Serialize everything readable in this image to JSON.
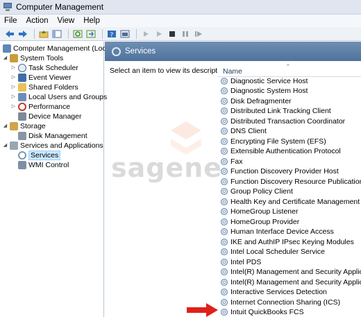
{
  "window": {
    "title": "Computer Management"
  },
  "menu": {
    "items": [
      "File",
      "Action",
      "View",
      "Help"
    ]
  },
  "toolbar": {
    "icons": [
      "back-arrow",
      "forward-arrow",
      "up-folder",
      "show-hide-tree",
      "refresh",
      "export",
      "help",
      "properties",
      "play",
      "play-next",
      "stop",
      "pause",
      "restart"
    ]
  },
  "tree": {
    "root": "Computer Management (Local)",
    "system_tools": "System Tools",
    "task_scheduler": "Task Scheduler",
    "event_viewer": "Event Viewer",
    "shared_folders": "Shared Folders",
    "local_users": "Local Users and Groups",
    "performance": "Performance",
    "device_manager": "Device Manager",
    "storage": "Storage",
    "disk_management": "Disk Management",
    "services_apps": "Services and Applications",
    "services": "Services",
    "wmi_control": "WMI Control"
  },
  "main": {
    "header_title": "Services",
    "description": "Select an item to view its description.",
    "column_name": "Name"
  },
  "services": [
    "Diagnostic Service Host",
    "Diagnostic System Host",
    "Disk Defragmenter",
    "Distributed Link Tracking Client",
    "Distributed Transaction Coordinator",
    "DNS Client",
    "Encrypting File System (EFS)",
    "Extensible Authentication Protocol",
    "Fax",
    "Function Discovery Provider Host",
    "Function Discovery Resource Publication",
    "Group Policy Client",
    "Health Key and Certificate Management",
    "HomeGroup Listener",
    "HomeGroup Provider",
    "Human Interface Device Access",
    "IKE and AuthIP IPsec Keying Modules",
    "Intel Local Scheduler Service",
    "Intel PDS",
    "Intel(R) Management and Security Applicat...",
    "Intel(R) Management and Security Applicat...",
    "Interactive Services Detection",
    "Internet Connection Sharing (ICS)",
    "Intuit QuickBooks FCS"
  ],
  "watermark": {
    "text": "sagene"
  },
  "colors": {
    "header_band": "#5b7ea6",
    "arrow": "#e0201c",
    "selection": "#cce8ff"
  }
}
